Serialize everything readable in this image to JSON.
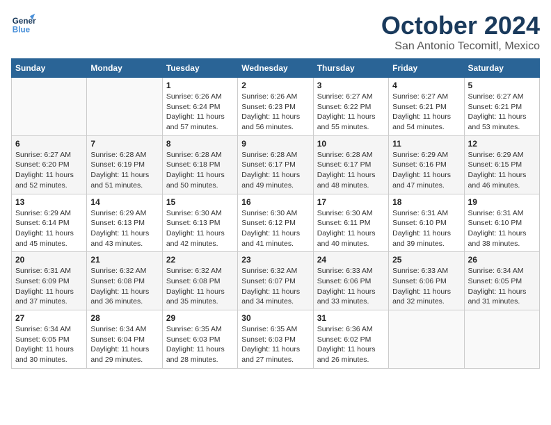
{
  "header": {
    "logo_general": "General",
    "logo_blue": "Blue",
    "month_title": "October 2024",
    "subtitle": "San Antonio Tecomitl, Mexico"
  },
  "columns": [
    "Sunday",
    "Monday",
    "Tuesday",
    "Wednesday",
    "Thursday",
    "Friday",
    "Saturday"
  ],
  "weeks": [
    [
      {
        "day": "",
        "info": ""
      },
      {
        "day": "",
        "info": ""
      },
      {
        "day": "1",
        "info": "Sunrise: 6:26 AM\nSunset: 6:24 PM\nDaylight: 11 hours and 57 minutes."
      },
      {
        "day": "2",
        "info": "Sunrise: 6:26 AM\nSunset: 6:23 PM\nDaylight: 11 hours and 56 minutes."
      },
      {
        "day": "3",
        "info": "Sunrise: 6:27 AM\nSunset: 6:22 PM\nDaylight: 11 hours and 55 minutes."
      },
      {
        "day": "4",
        "info": "Sunrise: 6:27 AM\nSunset: 6:21 PM\nDaylight: 11 hours and 54 minutes."
      },
      {
        "day": "5",
        "info": "Sunrise: 6:27 AM\nSunset: 6:21 PM\nDaylight: 11 hours and 53 minutes."
      }
    ],
    [
      {
        "day": "6",
        "info": "Sunrise: 6:27 AM\nSunset: 6:20 PM\nDaylight: 11 hours and 52 minutes."
      },
      {
        "day": "7",
        "info": "Sunrise: 6:28 AM\nSunset: 6:19 PM\nDaylight: 11 hours and 51 minutes."
      },
      {
        "day": "8",
        "info": "Sunrise: 6:28 AM\nSunset: 6:18 PM\nDaylight: 11 hours and 50 minutes."
      },
      {
        "day": "9",
        "info": "Sunrise: 6:28 AM\nSunset: 6:17 PM\nDaylight: 11 hours and 49 minutes."
      },
      {
        "day": "10",
        "info": "Sunrise: 6:28 AM\nSunset: 6:17 PM\nDaylight: 11 hours and 48 minutes."
      },
      {
        "day": "11",
        "info": "Sunrise: 6:29 AM\nSunset: 6:16 PM\nDaylight: 11 hours and 47 minutes."
      },
      {
        "day": "12",
        "info": "Sunrise: 6:29 AM\nSunset: 6:15 PM\nDaylight: 11 hours and 46 minutes."
      }
    ],
    [
      {
        "day": "13",
        "info": "Sunrise: 6:29 AM\nSunset: 6:14 PM\nDaylight: 11 hours and 45 minutes."
      },
      {
        "day": "14",
        "info": "Sunrise: 6:29 AM\nSunset: 6:13 PM\nDaylight: 11 hours and 43 minutes."
      },
      {
        "day": "15",
        "info": "Sunrise: 6:30 AM\nSunset: 6:13 PM\nDaylight: 11 hours and 42 minutes."
      },
      {
        "day": "16",
        "info": "Sunrise: 6:30 AM\nSunset: 6:12 PM\nDaylight: 11 hours and 41 minutes."
      },
      {
        "day": "17",
        "info": "Sunrise: 6:30 AM\nSunset: 6:11 PM\nDaylight: 11 hours and 40 minutes."
      },
      {
        "day": "18",
        "info": "Sunrise: 6:31 AM\nSunset: 6:10 PM\nDaylight: 11 hours and 39 minutes."
      },
      {
        "day": "19",
        "info": "Sunrise: 6:31 AM\nSunset: 6:10 PM\nDaylight: 11 hours and 38 minutes."
      }
    ],
    [
      {
        "day": "20",
        "info": "Sunrise: 6:31 AM\nSunset: 6:09 PM\nDaylight: 11 hours and 37 minutes."
      },
      {
        "day": "21",
        "info": "Sunrise: 6:32 AM\nSunset: 6:08 PM\nDaylight: 11 hours and 36 minutes."
      },
      {
        "day": "22",
        "info": "Sunrise: 6:32 AM\nSunset: 6:08 PM\nDaylight: 11 hours and 35 minutes."
      },
      {
        "day": "23",
        "info": "Sunrise: 6:32 AM\nSunset: 6:07 PM\nDaylight: 11 hours and 34 minutes."
      },
      {
        "day": "24",
        "info": "Sunrise: 6:33 AM\nSunset: 6:06 PM\nDaylight: 11 hours and 33 minutes."
      },
      {
        "day": "25",
        "info": "Sunrise: 6:33 AM\nSunset: 6:06 PM\nDaylight: 11 hours and 32 minutes."
      },
      {
        "day": "26",
        "info": "Sunrise: 6:34 AM\nSunset: 6:05 PM\nDaylight: 11 hours and 31 minutes."
      }
    ],
    [
      {
        "day": "27",
        "info": "Sunrise: 6:34 AM\nSunset: 6:05 PM\nDaylight: 11 hours and 30 minutes."
      },
      {
        "day": "28",
        "info": "Sunrise: 6:34 AM\nSunset: 6:04 PM\nDaylight: 11 hours and 29 minutes."
      },
      {
        "day": "29",
        "info": "Sunrise: 6:35 AM\nSunset: 6:03 PM\nDaylight: 11 hours and 28 minutes."
      },
      {
        "day": "30",
        "info": "Sunrise: 6:35 AM\nSunset: 6:03 PM\nDaylight: 11 hours and 27 minutes."
      },
      {
        "day": "31",
        "info": "Sunrise: 6:36 AM\nSunset: 6:02 PM\nDaylight: 11 hours and 26 minutes."
      },
      {
        "day": "",
        "info": ""
      },
      {
        "day": "",
        "info": ""
      }
    ]
  ]
}
